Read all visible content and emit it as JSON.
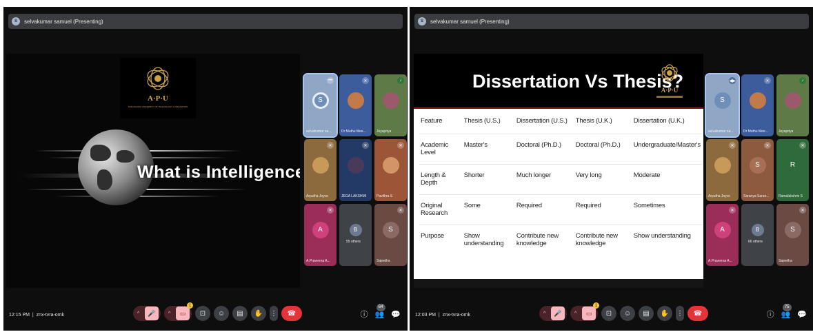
{
  "left": {
    "presenter": "selvakumar samuel (Presenting)",
    "presenter_initial": "S",
    "slide_title": "What is Intelligence?",
    "logo_text": "A·P·U",
    "logo_sub": "ASIA PACIFIC UNIVERSITY OF TECHNOLOGY & INNOVATION",
    "tiles": [
      {
        "name": "selvakumar sa...",
        "initial": "S",
        "bg": "#8fa6c4",
        "avatar_bg": "#6f8fb8"
      },
      {
        "name": "Dr Muthu Mee...",
        "initial": "",
        "bg": "#3c5c9c",
        "avatar_bg": "#c27a4a"
      },
      {
        "name": "Jeyapriya",
        "initial": "",
        "bg": "#5e7a46",
        "avatar_bg": "#9b5a6c"
      },
      {
        "name": "Arputha Joyce",
        "initial": "",
        "bg": "#8d6a3e",
        "avatar_bg": "#c89a5a"
      },
      {
        "name": "JEGA LAKSHMI",
        "initial": "",
        "bg": "#233a66",
        "avatar_bg": "#4a3a5a"
      },
      {
        "name": "Pavithra S",
        "initial": "",
        "bg": "#9c5536",
        "avatar_bg": "#d39466"
      },
      {
        "name": "A.Praveena A...",
        "initial": "A",
        "bg": "#9b2e58",
        "avatar_bg": "#d0407a"
      },
      {
        "name": "55 others",
        "initial": "B",
        "bg": "#3f4247",
        "avatar_bg": "#6e7a90"
      },
      {
        "name": "Sajeetha",
        "initial": "S",
        "bg": "#6b4a44",
        "avatar_bg": "#8a6a64"
      }
    ],
    "time": "12:15 PM",
    "meeting_code": "znx-tvra-omk",
    "participant_count": "64",
    "notif_count": "1"
  },
  "right": {
    "presenter": "selvakumar samuel (Presenting)",
    "presenter_initial": "S",
    "slide_title": "Dissertation Vs Thesis?",
    "logo_text": "A·P·U",
    "table_header": [
      "Feature",
      "Thesis (U.S.)",
      "Dissertation (U.S.)",
      "Thesis (U.K.)",
      "Dissertation (U.K.)"
    ],
    "table_rows": [
      [
        "Academic Level",
        "Master's",
        "Doctoral (Ph.D.)",
        "Doctoral (Ph.D.)",
        "Undergraduate/Master's"
      ],
      [
        "Length & Depth",
        "Shorter",
        "Much longer",
        "Very long",
        "Moderate"
      ],
      [
        "Original Research",
        "Some",
        "Required",
        "Required",
        "Sometimes"
      ],
      [
        "Purpose",
        "Show understanding",
        "Contribute new knowledge",
        "Contribute new knowledge",
        "Show understanding"
      ]
    ],
    "tiles": [
      {
        "name": "selvakumar sa...",
        "initial": "S",
        "bg": "#8fa6c4",
        "avatar_bg": "#6f8fb8"
      },
      {
        "name": "Dr Muthu Mee...",
        "initial": "",
        "bg": "#3c5c9c",
        "avatar_bg": "#c27a4a"
      },
      {
        "name": "Jeyapriya",
        "initial": "",
        "bg": "#5e7a46",
        "avatar_bg": "#9b5a6c"
      },
      {
        "name": "Arputha Joyce",
        "initial": "",
        "bg": "#8d6a3e",
        "avatar_bg": "#c89a5a"
      },
      {
        "name": "Saranya Saran...",
        "initial": "S",
        "bg": "#8d5a3e",
        "avatar_bg": "#a77055"
      },
      {
        "name": "Ramalakshmi S",
        "initial": "R",
        "bg": "#2f6a3a",
        "avatar_bg": "#2f6a3a"
      },
      {
        "name": "A.Praveena A...",
        "initial": "A",
        "bg": "#9b2e58",
        "avatar_bg": "#d0407a"
      },
      {
        "name": "66 others",
        "initial": "B",
        "bg": "#3f4247",
        "avatar_bg": "#6e7a90"
      },
      {
        "name": "Sajeetha",
        "initial": "S",
        "bg": "#6b4a44",
        "avatar_bg": "#8a6a64"
      }
    ],
    "time": "12:03 PM",
    "meeting_code": "znx-tvra-omk",
    "participant_count": "75",
    "notif_count": "1"
  },
  "icons": {
    "mic": "mic-off-icon",
    "camera": "camera-off-icon",
    "present": "present-icon",
    "emoji": "emoji-icon",
    "captions": "captions-icon",
    "hand": "raise-hand-icon",
    "more": "more-vert-icon",
    "end": "end-call-icon",
    "info": "info-icon",
    "people": "people-icon",
    "chat": "chat-icon"
  }
}
